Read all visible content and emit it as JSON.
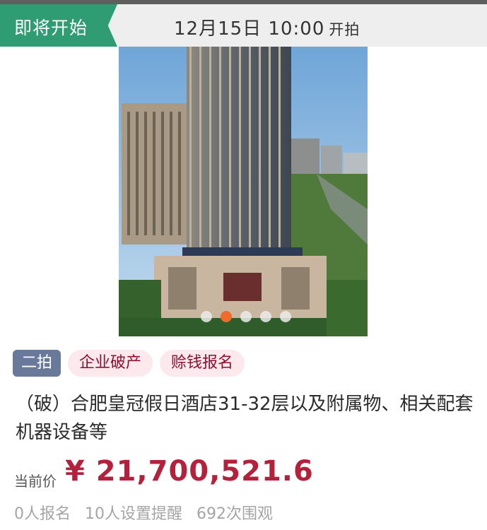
{
  "status": {
    "label": "即将开始",
    "start_time": "12月15日 10:00",
    "start_suffix": "开拍"
  },
  "gallery": {
    "image_alt": "高层酒店建筑外景照片",
    "dot_count": 5,
    "active_index": 1
  },
  "tags": {
    "round": "二拍",
    "category": "企业破产",
    "mode": "赊钱报名"
  },
  "title": "（破）合肥皇冠假日酒店31-32层以及附属物、相关配套机器设备等",
  "price": {
    "label": "当前价",
    "value": "¥ 21,700,521.6"
  },
  "stats": {
    "signups": "0人报名",
    "reminders": "10人设置提醒",
    "views": "692次围观"
  },
  "colors": {
    "status_green": "#2f9c73",
    "price_red": "#b3213c",
    "round_badge": "#68799a",
    "pill_bg": "#fbe9ee"
  }
}
